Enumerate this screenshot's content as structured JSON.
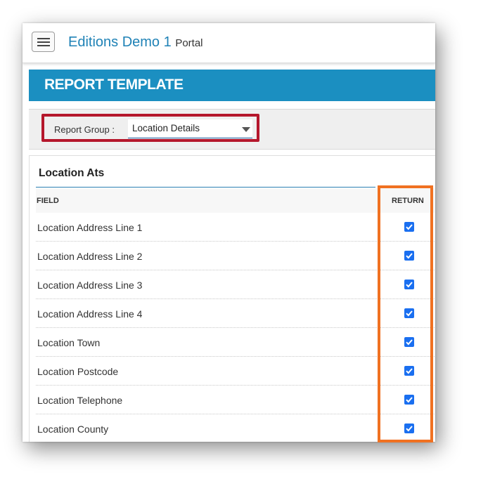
{
  "header": {
    "title": "Editions Demo 1",
    "subtitle": "Portal"
  },
  "section": {
    "title": "REPORT TEMPLATE"
  },
  "filter": {
    "label": "Report Group :",
    "selected": "Location Details"
  },
  "card": {
    "title": "Location Ats",
    "columns": {
      "field": "FIELD",
      "return": "RETURN"
    },
    "rows": [
      {
        "field": "Location Address Line 1",
        "return": true
      },
      {
        "field": "Location Address Line 2",
        "return": true
      },
      {
        "field": "Location Address Line 3",
        "return": true
      },
      {
        "field": "Location Address Line 4",
        "return": true
      },
      {
        "field": "Location Town",
        "return": true
      },
      {
        "field": "Location Postcode",
        "return": true
      },
      {
        "field": "Location Telephone",
        "return": true
      },
      {
        "field": "Location County",
        "return": true
      }
    ]
  },
  "colors": {
    "accent": "#1b8fc1",
    "title": "#1f82b6",
    "highlight_red": "#b5172c",
    "highlight_orange": "#f07121",
    "checkbox": "#1a6ff0"
  }
}
